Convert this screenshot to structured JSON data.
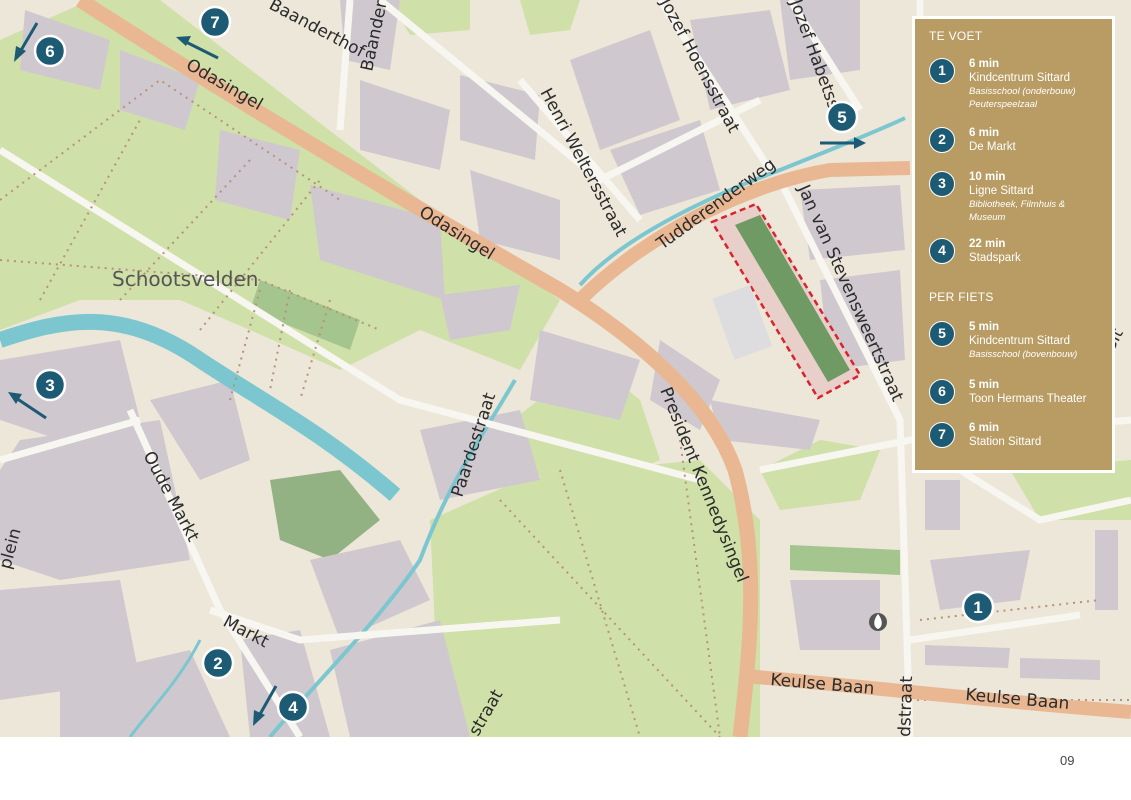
{
  "map": {
    "area_label": "Schootsvelden",
    "streets": {
      "baanderthof": "Baanderthof",
      "baandert": "Baandert",
      "odasingel_1": "Odasingel",
      "odasingel_2": "Odasingel",
      "henri_welters": "Henri Weltersstraat",
      "jozef_hoens": "Jozef Hoensstraat",
      "jozef_habets": "Jozef Habetsst",
      "tudderenderweg": "Tudderenderweg",
      "jan_van_stevens": "Jan van Stevensweertstraat",
      "oude_markt": "Oude Markt",
      "paardestraat": "Paardestraat",
      "president_kennedy": "President Kennedysingel",
      "markt": "Markt",
      "keulse_baan_1": "Keulse Baan",
      "keulse_baan_2": "Keulse Baan",
      "edge_plein": "plein",
      "edge_straat": "straat",
      "edge_dstraat": "dstraat",
      "edge_sit": "Sit"
    },
    "markers": [
      "1",
      "2",
      "3",
      "4",
      "5",
      "6",
      "7"
    ]
  },
  "legend": {
    "walk_heading": "TE VOET",
    "bike_heading": "PER FIETS",
    "items": [
      {
        "num": "1",
        "time": "6 min",
        "place": "Kindcentrum Sittard",
        "sub": "Basisschool (onderbouw)",
        "sub2": "Peuterspeelzaal"
      },
      {
        "num": "2",
        "time": "6 min",
        "place": "De Markt",
        "sub": "",
        "sub2": ""
      },
      {
        "num": "3",
        "time": "10 min",
        "place": "Ligne Sittard",
        "sub": "Bibliotheek, Filmhuis &",
        "sub2": "Museum"
      },
      {
        "num": "4",
        "time": "22 min",
        "place": "Stadspark",
        "sub": "",
        "sub2": ""
      },
      {
        "num": "5",
        "time": "5 min",
        "place": "Kindcentrum Sittard",
        "sub": "Basisschool (bovenbouw)",
        "sub2": ""
      },
      {
        "num": "6",
        "time": "5 min",
        "place": "Toon Hermans Theater",
        "sub": "",
        "sub2": ""
      },
      {
        "num": "7",
        "time": "6 min",
        "place": "Station Sittard",
        "sub": "",
        "sub2": ""
      }
    ]
  },
  "colors": {
    "marker": "#1d5a73",
    "legend_bg": "#b89c63",
    "main_road": "#e9b893",
    "water": "#7cc7cf",
    "park": "#cfe0a8",
    "building": "#cfc9cf",
    "site_outline": "#d9232d"
  },
  "page_number": "09"
}
